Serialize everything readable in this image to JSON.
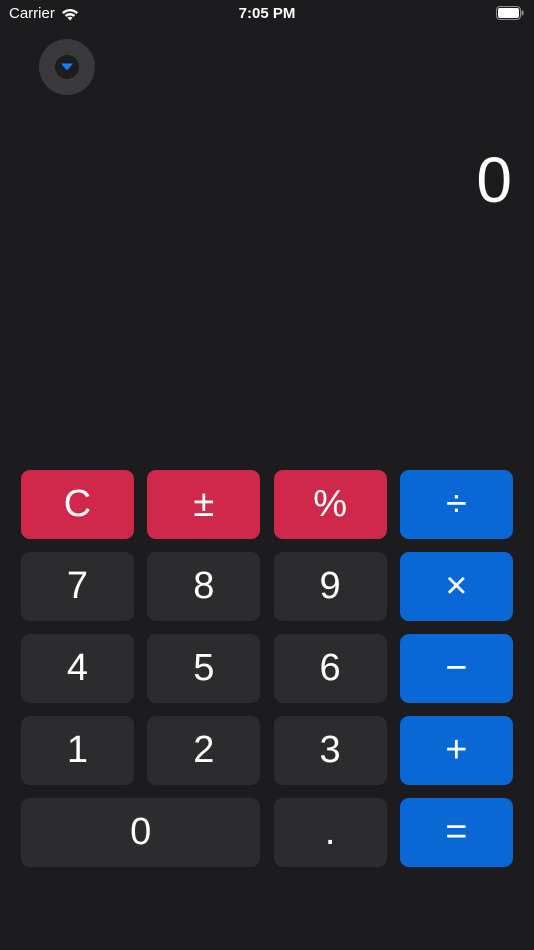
{
  "status_bar": {
    "carrier": "Carrier",
    "time": "7:05 PM"
  },
  "display": {
    "value": "0"
  },
  "colors": {
    "background": "#1c1c1e",
    "digit_key": "#2c2c2e",
    "function_key": "#d0284b",
    "operator_key": "#0a67d6",
    "accent_arrow": "#1a7ef0"
  },
  "icons": {
    "collapse": "chevron-down-icon",
    "wifi": "wifi-icon",
    "battery": "battery-icon"
  },
  "keys": {
    "clear": "C",
    "sign": "±",
    "percent": "%",
    "divide": "÷",
    "seven": "7",
    "eight": "8",
    "nine": "9",
    "multiply": "×",
    "four": "4",
    "five": "5",
    "six": "6",
    "minus": "−",
    "one": "1",
    "two": "2",
    "three": "3",
    "plus": "+",
    "zero": "0",
    "decimal": ".",
    "equals": "="
  }
}
